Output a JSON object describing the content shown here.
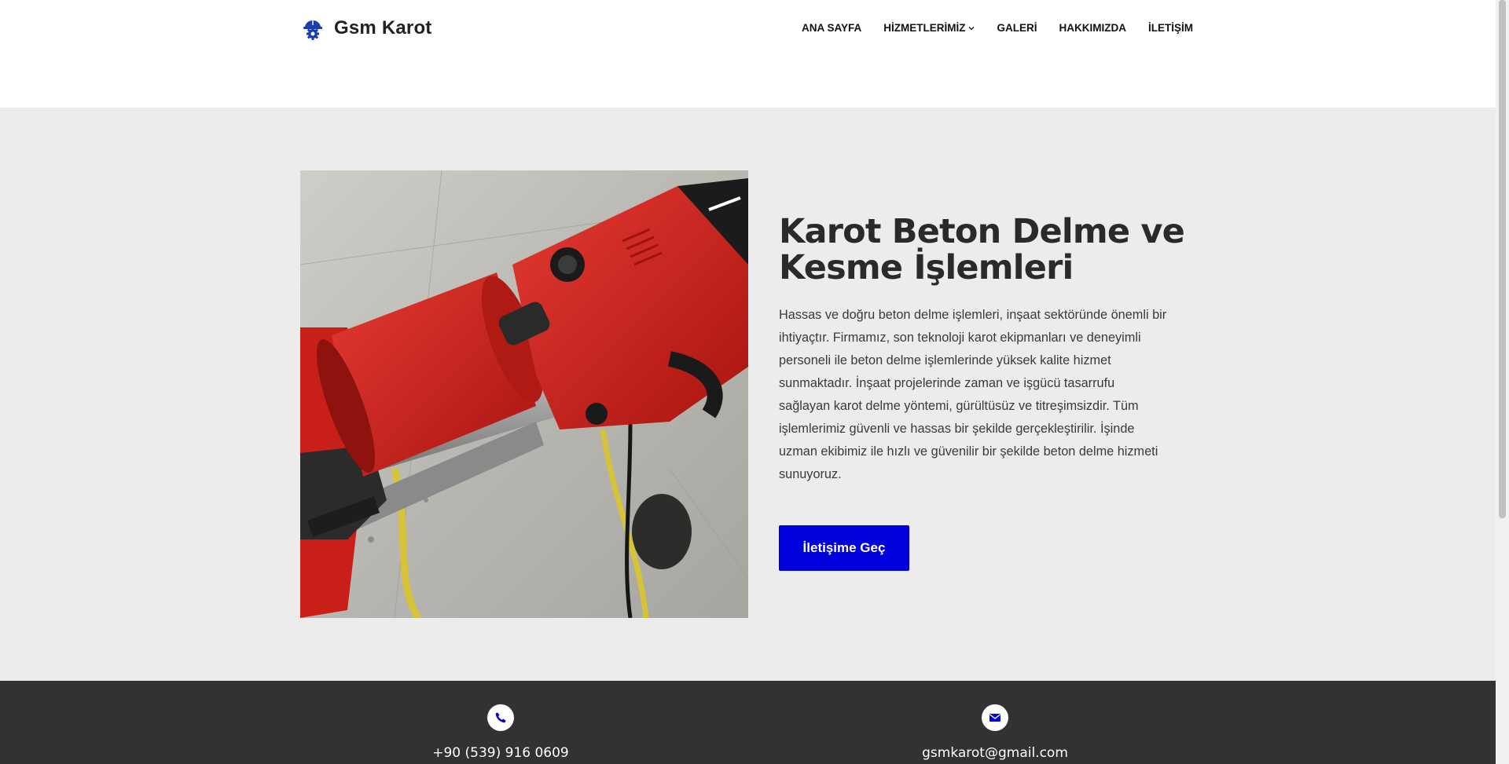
{
  "header": {
    "brand": "Gsm Karot",
    "nav": [
      {
        "label": "ANA SAYFA"
      },
      {
        "label": "HİZMETLERİMİZ",
        "has_dropdown": true
      },
      {
        "label": "GALERİ"
      },
      {
        "label": "HAKKIMIZDA"
      },
      {
        "label": "İLETİŞİM"
      }
    ]
  },
  "hero": {
    "title": "Karot Beton Delme ve Kesme İşlemleri",
    "paragraph": "Hassas ve doğru beton delme işlemleri, inşaat sektöründe önemli bir ihtiyaçtır. Firmamız, son teknoloji karot ekipmanları ve deneyimli personeli ile beton delme işlemlerinde yüksek kalite hizmet sunmaktadır. İnşaat projelerinde zaman ve işgücü tasarrufu sağlayan karot delme yöntemi, gürültüsüz ve titreşimsizdir. Tüm işlemlerimiz güvenli ve hassas bir şekilde gerçekleştirilir. İşinde uzman ekibimiz ile hızlı ve güvenilir bir şekilde beton delme hizmeti sunuyoruz.",
    "cta_label": "İletişime Geç",
    "image_alt": "core-drill-on-concrete-wall"
  },
  "footer": {
    "phone": "+90 (539) 916 0609",
    "email": "gsmkarot@gmail.com"
  },
  "colors": {
    "accent": "#0000dd",
    "hero_bg": "#ececec",
    "footer_bg": "#323232",
    "logo_blue": "#1a3fa8"
  },
  "icons": {
    "logo": "helmet-gear-icon",
    "phone": "phone-icon",
    "email": "envelope-icon",
    "dropdown": "chevron-down-icon"
  }
}
